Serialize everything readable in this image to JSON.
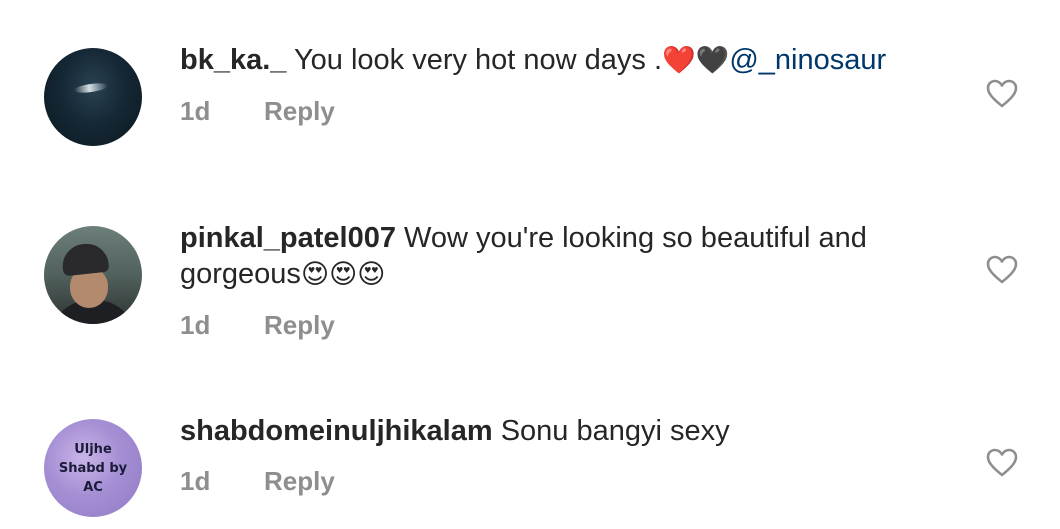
{
  "comments": [
    {
      "username": "bk_ka._",
      "text": " You look very hot now days .",
      "emoji": "❤️🖤",
      "mention": "@_ninosaur",
      "time": "1d",
      "reply_label": "Reply",
      "avatar": "ocean-wave-photo"
    },
    {
      "username": "pinkal_patel007",
      "text": " Wow you're looking so beautiful and gorgeous",
      "emoji": "😍😍😍",
      "time": "1d",
      "reply_label": "Reply",
      "avatar": "man-in-cap-photo"
    },
    {
      "username": "shabdomeinuljhikalam",
      "text": " Sonu bangyi sexy",
      "time": "1d",
      "reply_label": "Reply",
      "avatar_text": "Uljhe Shabd by AC"
    }
  ],
  "icons": {
    "like": "heart-outline-icon"
  },
  "colors": {
    "text": "#262626",
    "meta": "#8e8e8e",
    "mention": "#00376b"
  }
}
